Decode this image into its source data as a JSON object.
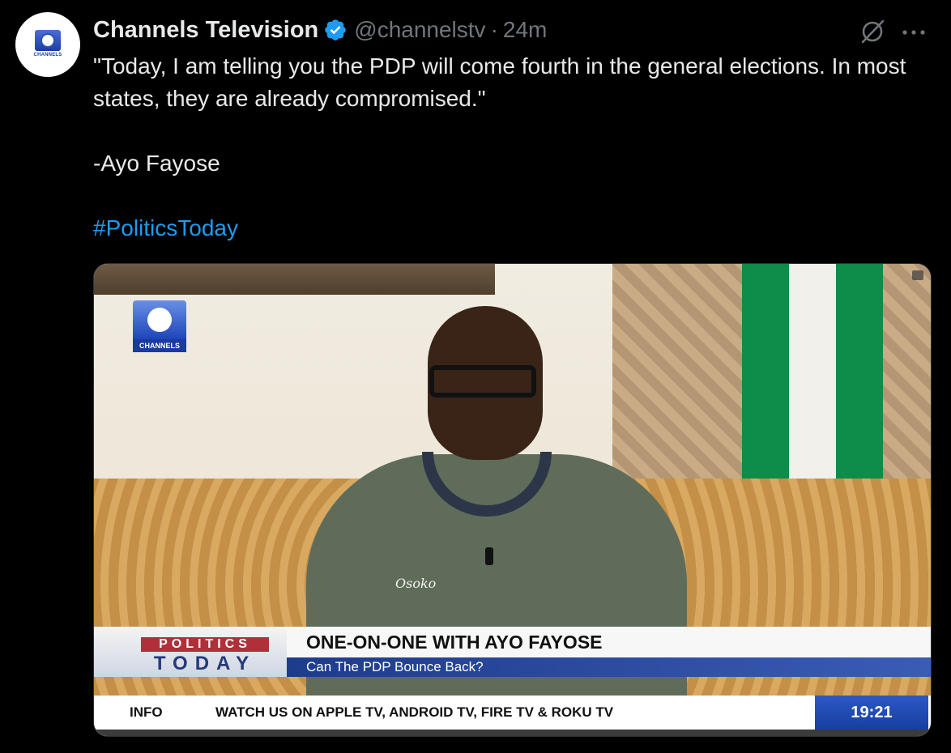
{
  "account": {
    "display_name": "Channels Television",
    "handle": "@channelstv",
    "separator": "·",
    "time": "24m",
    "verified": true,
    "avatar_logo_text": "CHANNELS"
  },
  "tweet": {
    "quote": "\"Today, I am telling you the PDP will come fourth in the general elections. In most states, they are already compromised.\"",
    "attribution": "-Ayo Fayose",
    "hashtag": "#PoliticsToday"
  },
  "media": {
    "channel_logo_text": "CHANNELS",
    "shirt_text": "Osoko",
    "program_top": "POLITICS",
    "program_bottom": "TODAY",
    "headline": "ONE-ON-ONE WITH AYO FAYOSE",
    "subheadline": "Can The PDP Bounce Back?",
    "ticker_label": "INFO",
    "ticker_text": "WATCH US ON APPLE TV, ANDROID TV, FIRE TV & ROKU TV",
    "clock": "19:21"
  },
  "colors": {
    "background": "#000000",
    "text": "#e7e9ea",
    "secondary": "#71767b",
    "link": "#1d9bf0",
    "verified_badge": "#1d9bf0"
  },
  "icons": {
    "verified": "verified-badge-icon",
    "grok": "grok-icon",
    "more": "more-dots-icon"
  }
}
